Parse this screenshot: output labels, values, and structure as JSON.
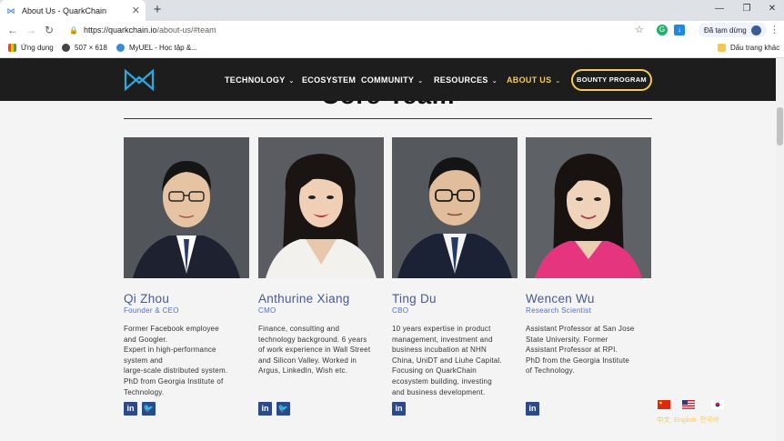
{
  "browser": {
    "tab_title": "About Us - QuarkChain",
    "url_host": "https://quarkchain.io",
    "url_path": "/about-us/#team",
    "profile_label": "Đã tạm dừng",
    "bookmarks": {
      "apps": "Ứng dụng",
      "size": "507 × 618",
      "myuel": "MyUEL - Học tập &...",
      "other": "Dấu trang khác"
    }
  },
  "site": {
    "nav": [
      {
        "label": "TECHNOLOGY",
        "has_menu": true
      },
      {
        "label": "ECOSYSTEM",
        "has_menu": false
      },
      {
        "label": "COMMUNITY",
        "has_menu": true
      },
      {
        "label": "RESOURCES",
        "has_menu": true
      },
      {
        "label": "ABOUT US",
        "has_menu": true
      }
    ],
    "bounty_button": "BOUNTY PROGRAM",
    "section_title": "Core Team",
    "accent_color": "#f7c95a",
    "name_color": "#4a5a8c",
    "team": [
      {
        "name": "Qi Zhou",
        "role": "Founder & CEO",
        "bio": [
          "Former Facebook employee",
          "and Googler.",
          "Expert in high-performance",
          "system and",
          "large-scale distributed system.",
          "PhD from Georgia Institute of",
          "Technology."
        ],
        "socials": [
          "linkedin-icon",
          "twitter-icon"
        ]
      },
      {
        "name": "Anthurine Xiang",
        "role": "CMO",
        "bio": [
          "Finance, consulting and",
          "technology background. 6 years",
          "of work experience in Wall Street",
          "and Silicon Valley. Worked in",
          "Argus, LinkedIn, Wish etc."
        ],
        "socials": [
          "linkedin-icon",
          "twitter-icon"
        ]
      },
      {
        "name": "Ting Du",
        "role": "CBO",
        "bio": [
          "10 years expertise in product",
          "management, investment and",
          "business incubation at NHN",
          "China, UniDT and Liuhe Capital.",
          "Focusing on QuarkChain",
          "ecosystem building, investing",
          "and business development."
        ],
        "socials": [
          "linkedin-icon"
        ]
      },
      {
        "name": "Wencen Wu",
        "role": "Research Scientist",
        "bio": [
          "Assistant Professor at San Jose",
          "State University. Former",
          "Assistant Professor at RPI.",
          "PhD from the Georgia Institute",
          "of Technology."
        ],
        "socials": [
          "linkedin-icon"
        ]
      }
    ],
    "languages": [
      "中文",
      "English",
      "한국어"
    ]
  }
}
